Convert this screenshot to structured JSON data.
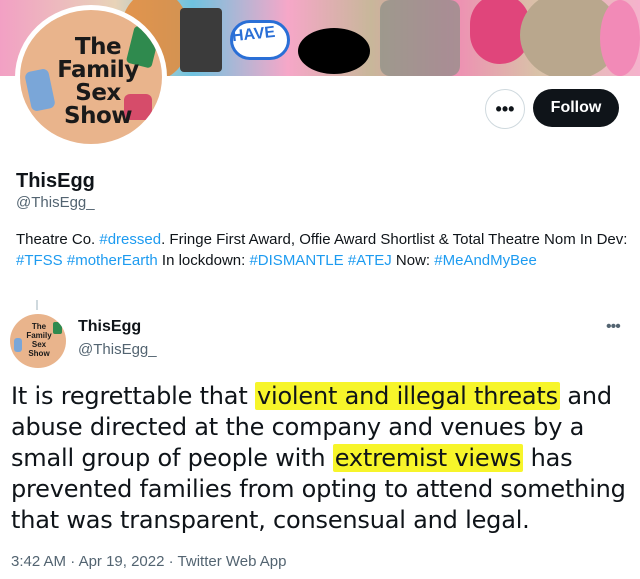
{
  "banner": {
    "collage_text": "HAVE"
  },
  "profile": {
    "avatar_logo": [
      "The",
      "Family",
      "Sex",
      "Show"
    ],
    "display_name": "ThisEgg",
    "handle": "@ThisEgg_",
    "bio": {
      "p1": "Theatre Co. ",
      "tag1": "#dressed",
      "p2": ". Fringe First Award, Offie Award Shortlist & Total Theatre Nom In Dev: ",
      "tag2": "#TFSS",
      "p3": " ",
      "tag3": "#motherEarth",
      "p4": " In lockdown: ",
      "tag4": "#DISMANTLE",
      "p5": " ",
      "tag5": "#ATEJ",
      "p6": " Now: ",
      "tag6": "#MeAndMyBee"
    }
  },
  "actions": {
    "more_label": "•••",
    "follow_label": "Follow"
  },
  "tweet": {
    "avatar_logo": "The Family Sex Show",
    "name": "ThisEgg",
    "handle": "@ThisEgg_",
    "more_label": "•••",
    "text": {
      "t1": "It is regrettable that ",
      "h1": "violent and illegal threats",
      "t2": " and abuse directed at the company and venues by a small group of people with ",
      "h2": "extremist views",
      "t3": " has prevented families from opting to attend something that was transparent, consensual and legal."
    },
    "time": "3:42 AM",
    "sep1": " · ",
    "date": "Apr 19, 2022",
    "sep2": " · ",
    "app": "Twitter Web App"
  },
  "colors": {
    "link": "#1d9bf0",
    "highlight": "#f7f52a",
    "follow_bg": "#0f1419",
    "muted": "#536471"
  }
}
